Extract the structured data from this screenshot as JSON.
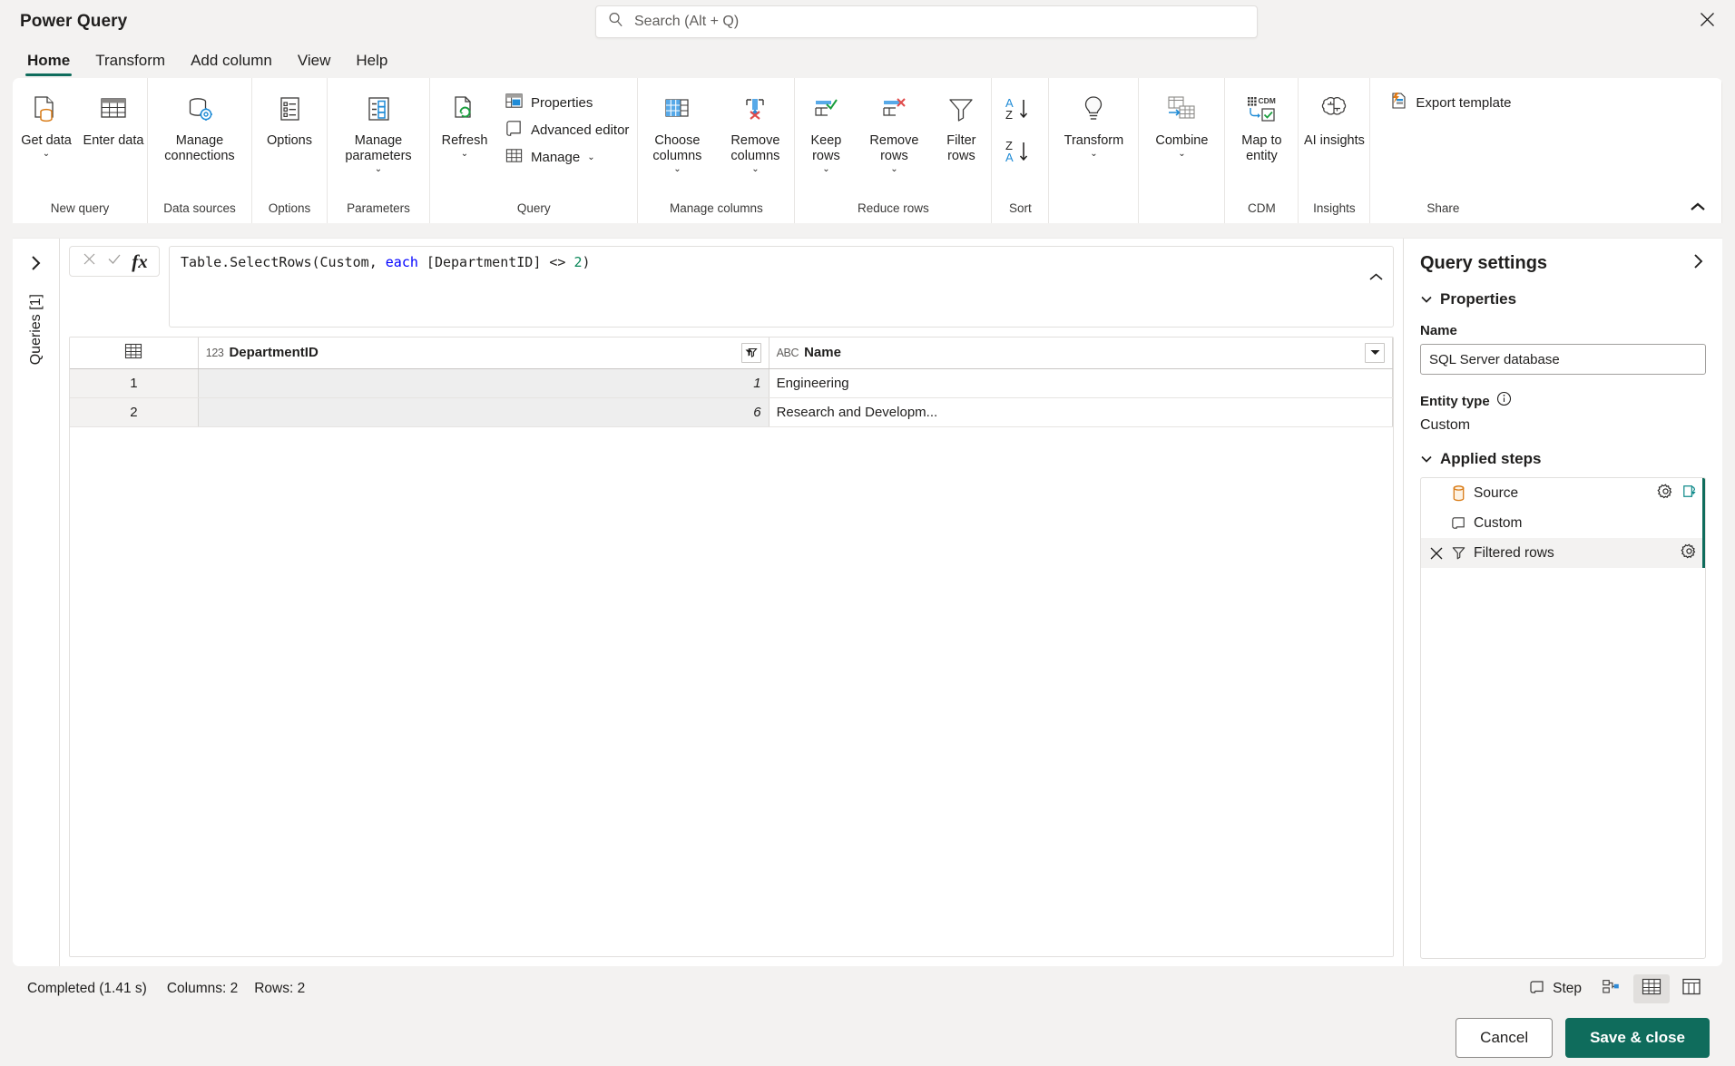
{
  "app": {
    "title": "Power Query"
  },
  "search": {
    "placeholder": "Search (Alt + Q)",
    "value": ""
  },
  "window": {
    "close_label": "Close"
  },
  "tabs": [
    {
      "label": "Home",
      "active": true
    },
    {
      "label": "Transform",
      "active": false
    },
    {
      "label": "Add column",
      "active": false
    },
    {
      "label": "View",
      "active": false
    },
    {
      "label": "Help",
      "active": false
    }
  ],
  "ribbon": {
    "groups": [
      {
        "name": "New query",
        "label": "New query",
        "buttons": [
          {
            "label": "Get data",
            "icon": "get-data-icon",
            "caret": true
          },
          {
            "label": "Enter data",
            "icon": "enter-data-icon",
            "caret": false
          }
        ]
      },
      {
        "name": "Data sources",
        "label": "Data sources",
        "buttons": [
          {
            "label": "Manage connections",
            "icon": "manage-connections-icon",
            "caret": false
          }
        ]
      },
      {
        "name": "Options",
        "label": "Options",
        "buttons": [
          {
            "label": "Options",
            "icon": "options-icon",
            "caret": false
          }
        ]
      },
      {
        "name": "Parameters",
        "label": "Parameters",
        "buttons": [
          {
            "label": "Manage parameters",
            "icon": "manage-parameters-icon",
            "caret": true
          }
        ]
      },
      {
        "name": "Query",
        "label": "Query",
        "buttons": [
          {
            "label": "Refresh",
            "icon": "refresh-icon",
            "caret": true
          }
        ],
        "small": [
          {
            "label": "Properties",
            "icon": "properties-icon",
            "caret": false
          },
          {
            "label": "Advanced editor",
            "icon": "advanced-editor-icon",
            "caret": false
          },
          {
            "label": "Manage",
            "icon": "manage-icon",
            "caret": true
          }
        ]
      },
      {
        "name": "Manage columns",
        "label": "Manage columns",
        "buttons": [
          {
            "label": "Choose columns",
            "icon": "choose-columns-icon",
            "caret": true
          },
          {
            "label": "Remove columns",
            "icon": "remove-columns-icon",
            "caret": true
          }
        ]
      },
      {
        "name": "Reduce rows",
        "label": "Reduce rows",
        "buttons": [
          {
            "label": "Keep rows",
            "icon": "keep-rows-icon",
            "caret": true
          },
          {
            "label": "Remove rows",
            "icon": "remove-rows-icon",
            "caret": true
          },
          {
            "label": "Filter rows",
            "icon": "filter-rows-icon",
            "caret": false
          }
        ]
      },
      {
        "name": "Sort",
        "label": "Sort",
        "sorts": [
          {
            "label": "Sort ascending",
            "icon": "sort-az-icon"
          },
          {
            "label": "Sort descending",
            "icon": "sort-za-icon"
          }
        ]
      },
      {
        "name": "Transform",
        "label": "",
        "buttons": [
          {
            "label": "Transform",
            "icon": "transform-idea-icon",
            "caret": true
          }
        ]
      },
      {
        "name": "Combine",
        "label": "",
        "buttons": [
          {
            "label": "Combine",
            "icon": "combine-icon",
            "caret": true
          }
        ]
      },
      {
        "name": "CDM",
        "label": "CDM",
        "buttons": [
          {
            "label": "Map to entity",
            "icon": "map-to-entity-icon",
            "caret": false
          }
        ]
      },
      {
        "name": "Insights",
        "label": "Insights",
        "buttons": [
          {
            "label": "AI insights",
            "icon": "ai-insights-icon",
            "caret": false
          }
        ]
      },
      {
        "name": "Share",
        "label": "Share",
        "small": [
          {
            "label": "Export template",
            "icon": "export-template-icon",
            "caret": false
          }
        ]
      }
    ],
    "collapse_label": "Collapse ribbon"
  },
  "queries_rail": {
    "expand_label": "Expand queries pane",
    "label": "Queries [1]"
  },
  "formula_bar": {
    "cancel_label": "Cancel",
    "accept_label": "Accept",
    "fx_label": "fx",
    "formula_parts": [
      {
        "text": "Table.SelectRows(Custom, ",
        "style": "plain"
      },
      {
        "text": "each",
        "style": "keyword"
      },
      {
        "text": " [DepartmentID] <> ",
        "style": "plain"
      },
      {
        "text": "2",
        "style": "number"
      },
      {
        "text": ")",
        "style": "plain"
      }
    ],
    "formula_text": "Table.SelectRows(Custom, each [DepartmentID] <> 2)",
    "collapse_label": "Collapse formula bar"
  },
  "grid": {
    "select_all_label": "Select all columns",
    "columns": [
      {
        "key": "DepartmentID",
        "label": "DepartmentID",
        "type_icon": "123",
        "highlighted": true,
        "header_button": "filter-applied-icon"
      },
      {
        "key": "Name",
        "label": "Name",
        "type_icon": "ABC",
        "highlighted": false,
        "header_button": "filter-icon"
      }
    ],
    "rows": [
      {
        "index": "1",
        "DepartmentID": "1",
        "Name": "Engineering"
      },
      {
        "index": "2",
        "DepartmentID": "6",
        "Name": "Research and Developm..."
      }
    ]
  },
  "query_settings": {
    "title": "Query settings",
    "expand_label": "Hide query settings",
    "properties_section": "Properties",
    "name_label": "Name",
    "name_value": "SQL Server database",
    "entity_type_label": "Entity type",
    "entity_type_info": "info-icon",
    "entity_type_value": "Custom",
    "applied_steps_section": "Applied steps",
    "steps": [
      {
        "label": "Source",
        "icon": "database-icon",
        "selected": false,
        "deletable": false,
        "gear": true,
        "refresh": true
      },
      {
        "label": "Custom",
        "icon": "script-icon",
        "selected": false,
        "deletable": false,
        "gear": false,
        "refresh": false
      },
      {
        "label": "Filtered rows",
        "icon": "filter-icon",
        "selected": true,
        "deletable": true,
        "gear": true,
        "refresh": false
      }
    ]
  },
  "status_bar": {
    "message": "Completed (1.41 s)",
    "columns_text": "Columns: 2",
    "rows_text": "Rows: 2",
    "step_label": "Step",
    "diagram_view_label": "Diagram view",
    "data_view_label": "Data view",
    "schema_view_label": "Schema view"
  },
  "footer": {
    "cancel_label": "Cancel",
    "save_label": "Save & close"
  },
  "colors": {
    "accent": "#0f6c5c",
    "highlight_column": "#d9f2ea",
    "chrome": "#f3f2f1"
  }
}
